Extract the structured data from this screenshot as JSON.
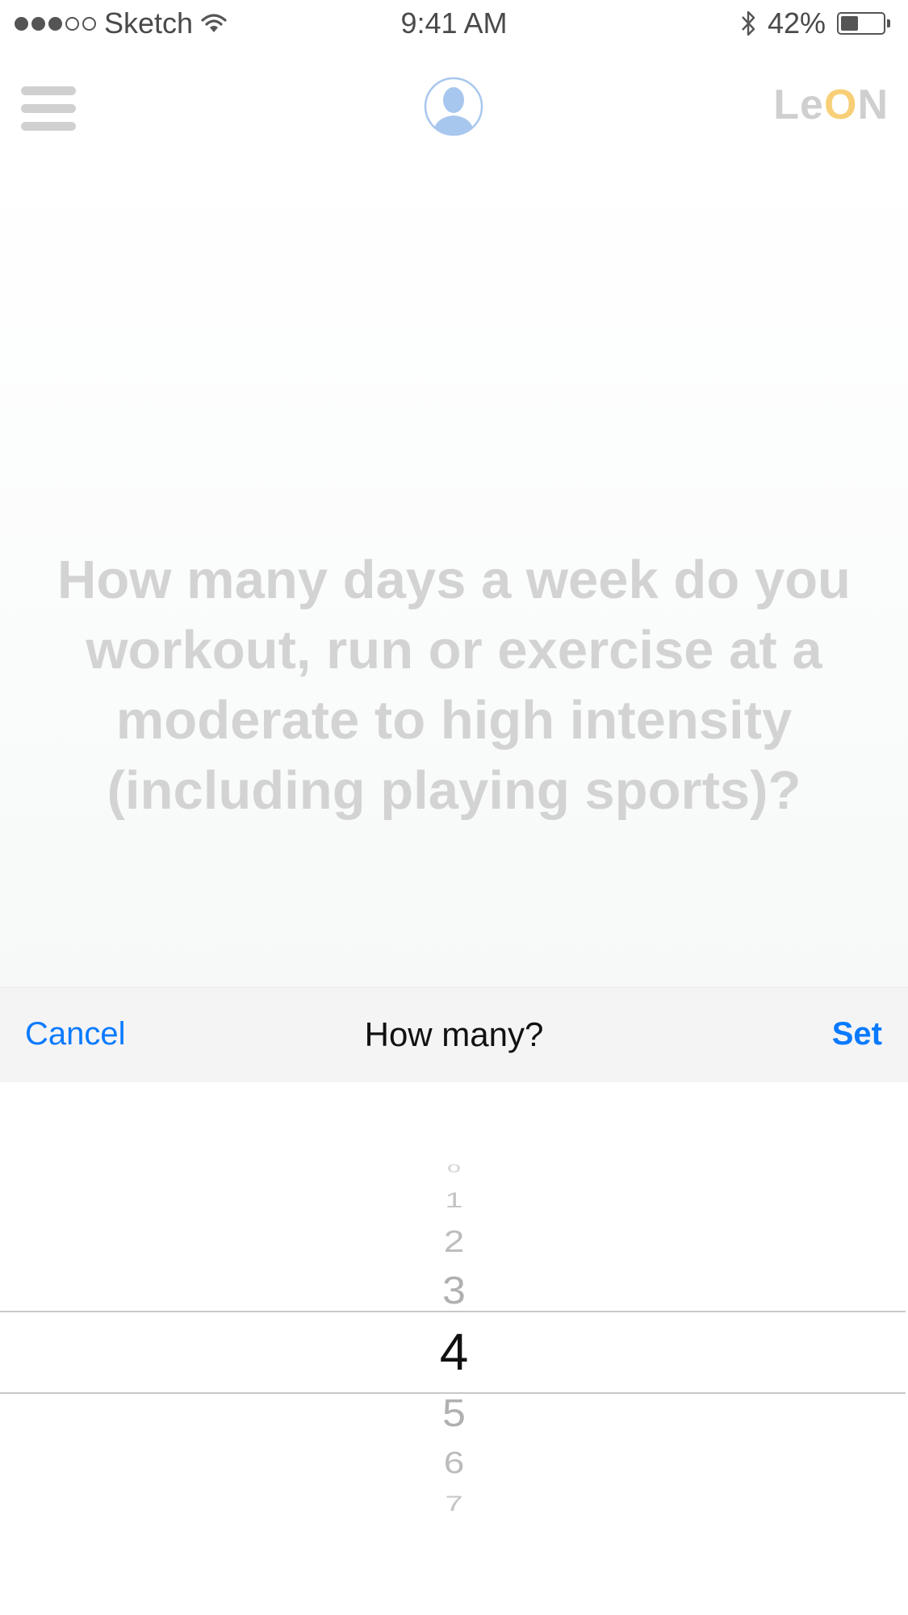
{
  "status_bar": {
    "carrier": "Sketch",
    "time": "9:41 AM",
    "battery_percent": "42%",
    "battery_level": 0.42,
    "icons": [
      "signal-dots",
      "wifi-icon",
      "bluetooth-icon",
      "battery-icon"
    ]
  },
  "header": {
    "logo_prefix": "Le",
    "logo_accent": "O",
    "logo_suffix": "N",
    "icons": [
      "menu-icon",
      "avatar-icon"
    ]
  },
  "question": {
    "text": "How many days a week do you workout, run or exercise at a moderate to high intensity (including playing sports)?"
  },
  "picker": {
    "title": "How many?",
    "cancel_label": "Cancel",
    "set_label": "Set",
    "options": [
      "0",
      "1",
      "2",
      "3",
      "4",
      "5",
      "6",
      "7"
    ],
    "selected": "4"
  },
  "colors": {
    "accent": "#0a7aff",
    "logo_accent": "#f8cf77",
    "question_text": "#d3d3d3",
    "toolbar_background": "#f4f4f4"
  }
}
